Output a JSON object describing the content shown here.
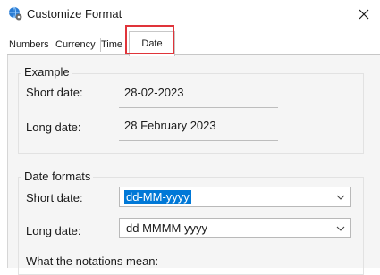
{
  "window": {
    "title": "Customize Format",
    "icon": "globe-settings-icon"
  },
  "tabs": [
    {
      "label": "Numbers"
    },
    {
      "label": "Currency"
    },
    {
      "label": "Time"
    },
    {
      "label": "Date",
      "selected": true
    }
  ],
  "example": {
    "title": "Example",
    "short_label": "Short date:",
    "short_value": "28-02-2023",
    "long_label": "Long date:",
    "long_value": "28 February 2023"
  },
  "formats": {
    "title": "Date formats",
    "short_label": "Short date:",
    "short_value": "dd-MM-yyyy",
    "long_label": "Long date:",
    "long_value": "dd MMMM yyyy",
    "notations_label": "What the notations mean:"
  },
  "colors": {
    "highlight": "#e0343a",
    "selection": "#0078d7"
  }
}
